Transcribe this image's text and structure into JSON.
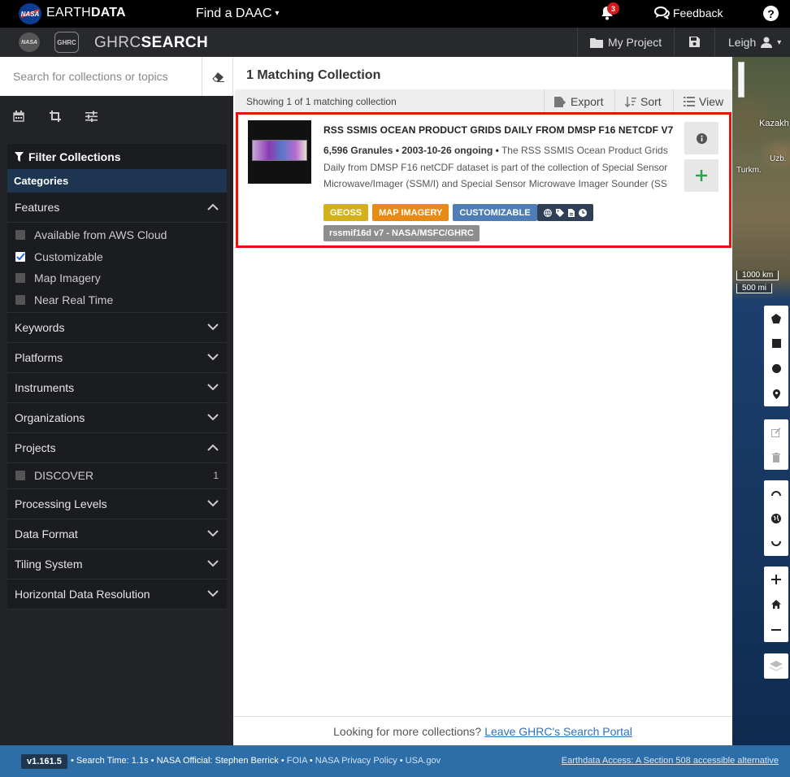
{
  "topbar": {
    "nasa_logo_text": "NASA",
    "brand_light": "EARTH",
    "brand_bold": "DATA",
    "find_daac": "Find a DAAC",
    "notification_count": "3",
    "feedback": "Feedback",
    "help": "?"
  },
  "subbar": {
    "nasa_text": "NASA",
    "ghrc_text": "GHRC",
    "title_light": "GHRC",
    "title_bold": "SEARCH",
    "my_project": "My Project",
    "user": "Leigh"
  },
  "search": {
    "placeholder": "Search for collections or topics",
    "value": ""
  },
  "filters": {
    "title": "Filter Collections",
    "categories_label": "Categories",
    "features": {
      "label": "Features",
      "options": [
        {
          "label": "Available from AWS Cloud",
          "checked": false
        },
        {
          "label": "Customizable",
          "checked": true
        },
        {
          "label": "Map Imagery",
          "checked": false
        },
        {
          "label": "Near Real Time",
          "checked": false
        }
      ]
    },
    "keywords": "Keywords",
    "platforms": "Platforms",
    "instruments": "Instruments",
    "organizations": "Organizations",
    "projects": {
      "label": "Projects",
      "options": [
        {
          "label": "DISCOVER",
          "count": "1"
        }
      ]
    },
    "processing_levels": "Processing Levels",
    "data_format": "Data Format",
    "tiling_system": "Tiling System",
    "horizontal_resolution": "Horizontal Data Resolution"
  },
  "results": {
    "heading": "1 Matching Collection",
    "showing": "Showing 1 of 1 matching collection",
    "export": "Export",
    "sort": "Sort",
    "view": "View"
  },
  "collection": {
    "title": "RSS SSMIS OCEAN PRODUCT GRIDS DAILY FROM DMSP F16 NETCDF V7",
    "meta": "6,596 Granules • 2003-10-26 ongoing •",
    "description": " The RSS SSMIS Ocean Product Grids Daily from DMSP F16 netCDF dataset is part of the collection of Special Sensor Microwave/Imager (SSM/I) and Special Sensor Microwave Imager Sounder (SSMIS) data products produced as part of NASA's MEaSUREs Program. Remote ...",
    "badges": [
      {
        "label": "GEOSS",
        "color": "#d4b11b"
      },
      {
        "label": "MAP IMAGERY",
        "color": "#e98a14"
      },
      {
        "label": "CUSTOMIZABLE",
        "color": "#4f7db8"
      }
    ],
    "short_name": "rssmif16d v7 - NASA/MSFC/GHRC"
  },
  "main_footer": {
    "text": "Looking for more collections?",
    "link": "Leave GHRC's Search Portal"
  },
  "map": {
    "labels": [
      "Kazakh",
      "Uzb.",
      "Turkm."
    ],
    "scale_km": "1000 km",
    "scale_mi": "500 mi"
  },
  "footer": {
    "version": "v1.161.5",
    "search_time": "Search Time: 1.1s",
    "official": "NASA Official: Stephen Berrick",
    "foia": "FOIA",
    "privacy": "NASA Privacy Policy",
    "usa": "USA.gov",
    "accessibility": "Earthdata Access: A Section 508 accessible alternative"
  }
}
